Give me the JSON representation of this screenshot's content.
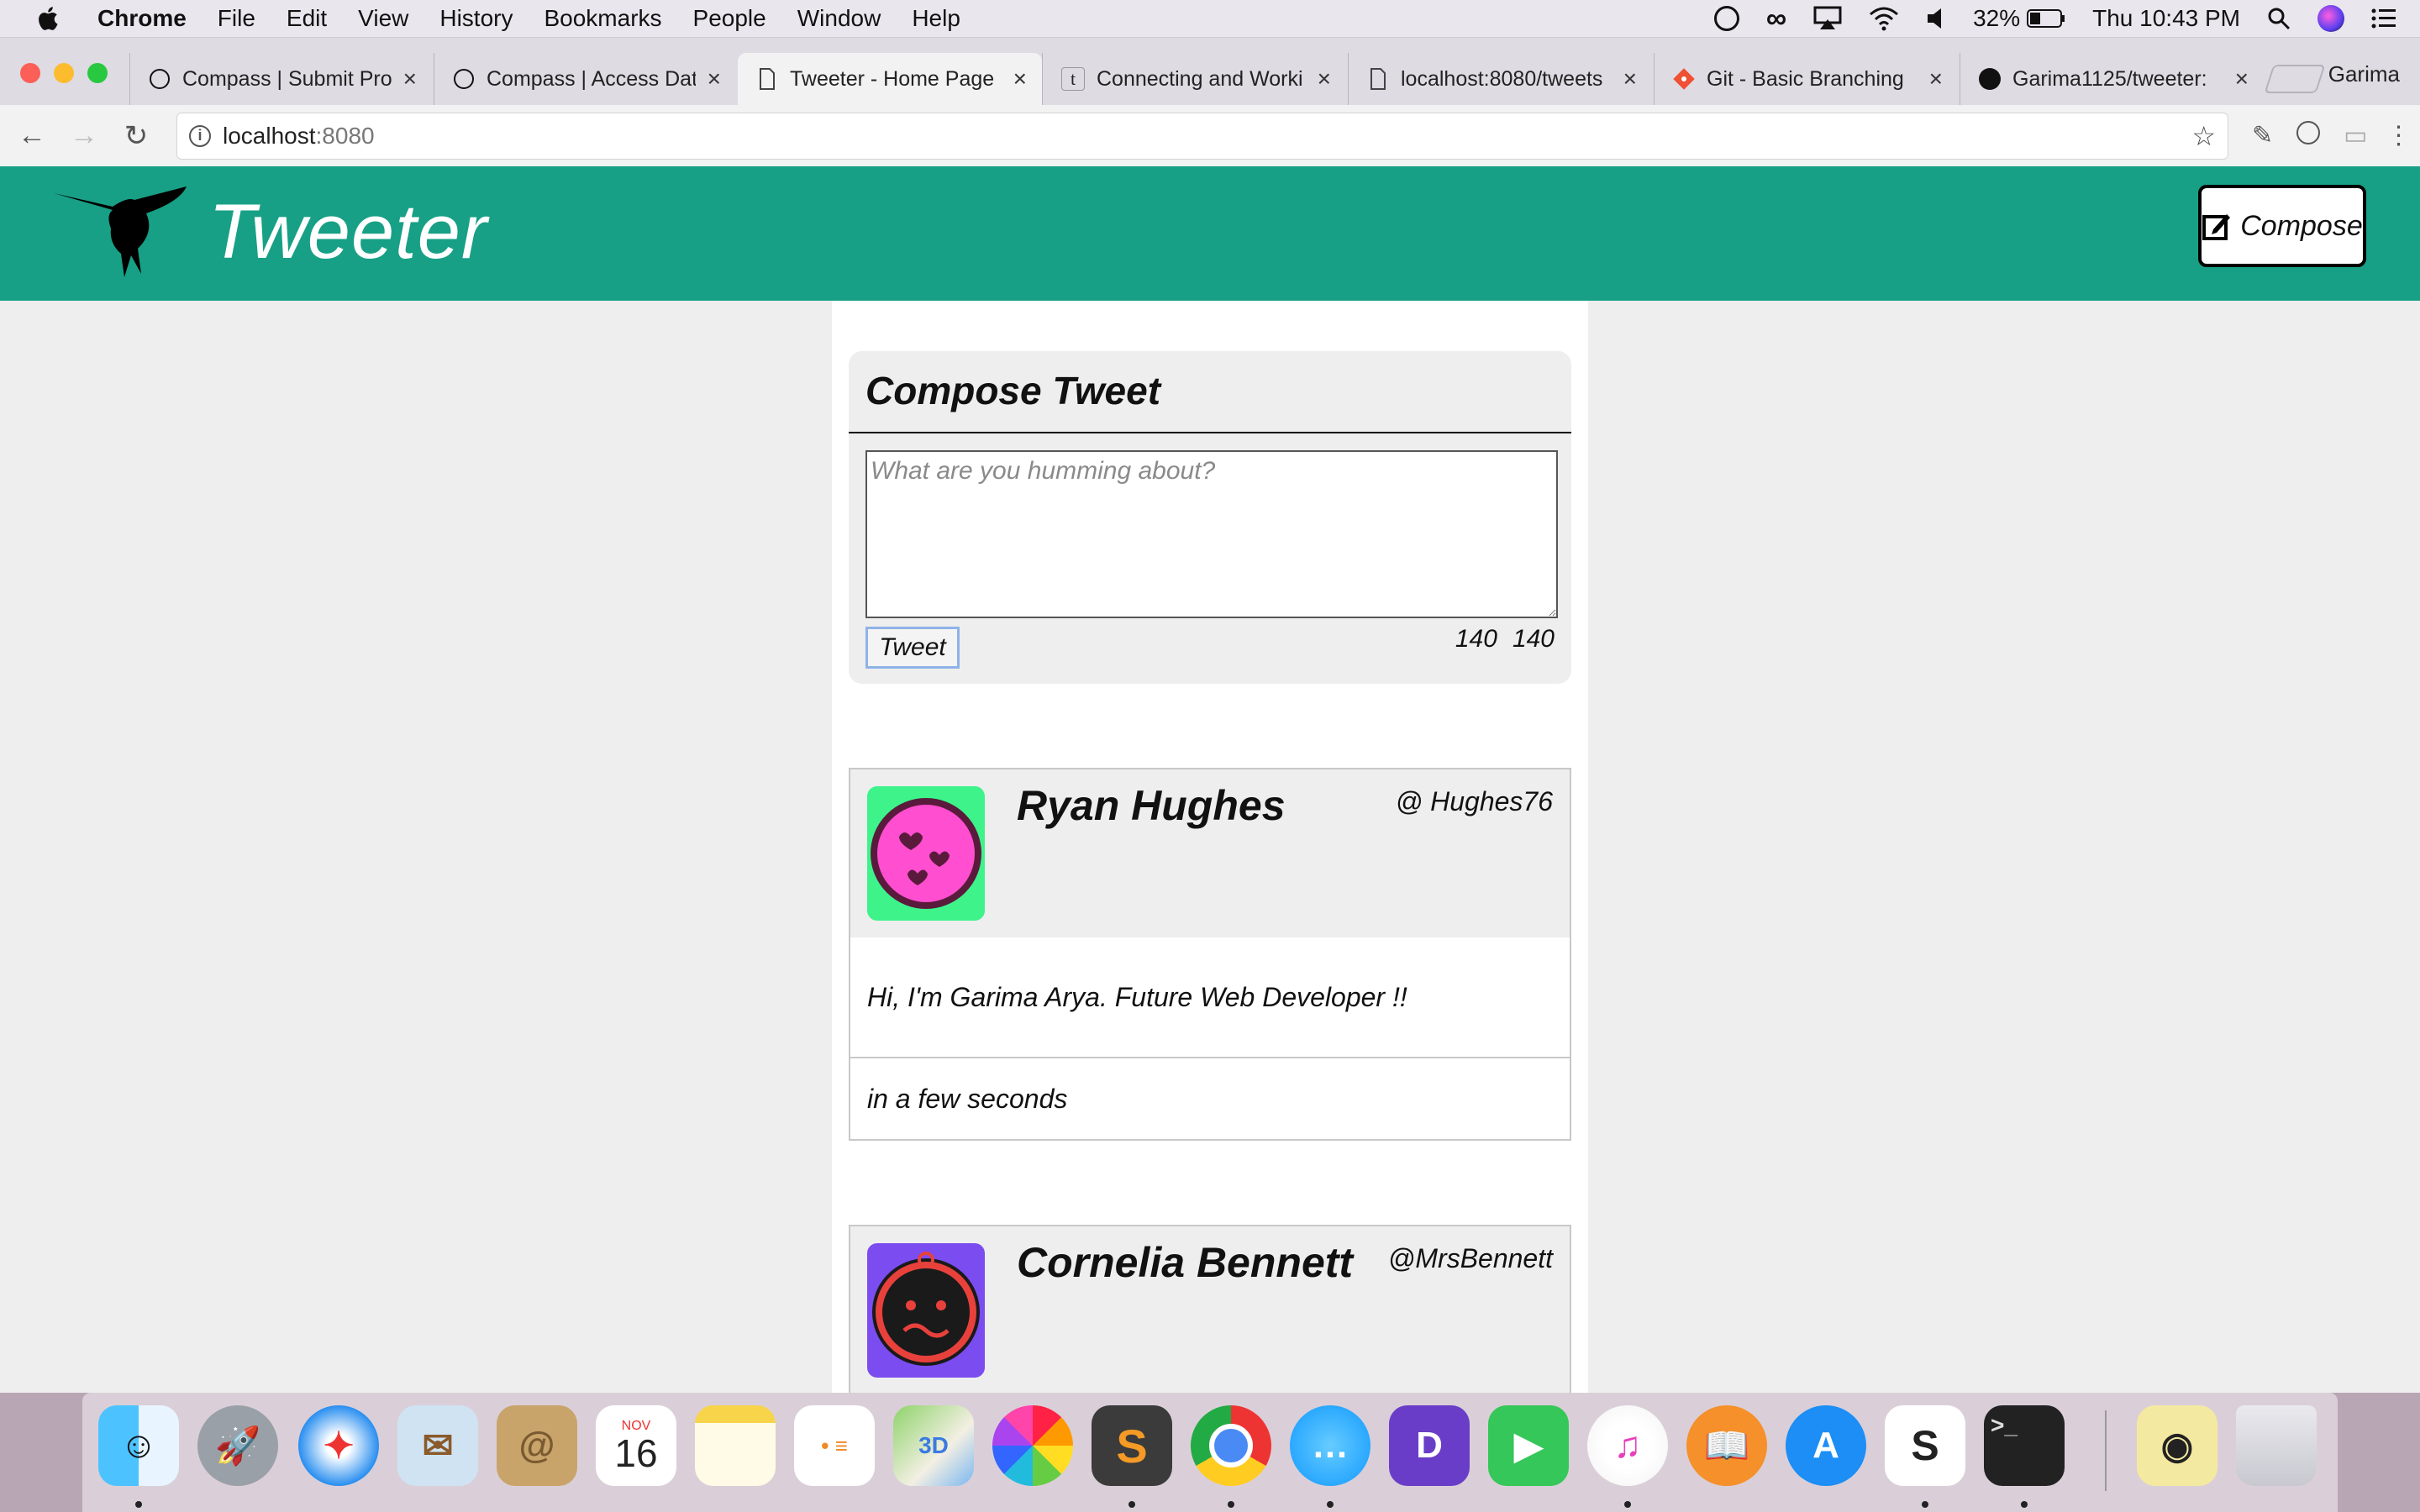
{
  "menubar": {
    "app": "Chrome",
    "menus": [
      "File",
      "Edit",
      "View",
      "History",
      "Bookmarks",
      "People",
      "Window",
      "Help"
    ],
    "battery": "32%",
    "clock": "Thu 10:43 PM"
  },
  "browser": {
    "tabs": [
      {
        "title": "Compass | Submit Pro",
        "icon": "compass-icon",
        "active": false
      },
      {
        "title": "Compass | Access Dat",
        "icon": "compass-icon",
        "active": false
      },
      {
        "title": "Tweeter - Home Page",
        "icon": "page-icon",
        "active": true
      },
      {
        "title": "Connecting and Worki",
        "icon": "t-icon",
        "active": false
      },
      {
        "title": "localhost:8080/tweets",
        "icon": "page-icon",
        "active": false
      },
      {
        "title": "Git - Basic Branching",
        "icon": "git-icon",
        "active": false
      },
      {
        "title": "Garima1125/tweeter:",
        "icon": "github-icon",
        "active": false
      }
    ],
    "profile_name": "Garima",
    "url_host": "localhost",
    "url_port": ":8080"
  },
  "app": {
    "brand": "Tweeter",
    "compose_button": "Compose",
    "new_tweet": {
      "heading": "Compose Tweet",
      "placeholder": "What are you humming about?",
      "submit_label": "Tweet",
      "counter_a": "140",
      "counter_b": "140"
    },
    "tweets": [
      {
        "name": "Ryan Hughes",
        "handle": "@ Hughes76",
        "text": "Hi, I'm Garima Arya. Future Web Developer !!",
        "time": "in a few seconds",
        "avatar_bg": "#3df38a",
        "avatar_face": "#ff4fd0"
      },
      {
        "name": "Cornelia Bennett",
        "handle": "@MrsBennett",
        "avatar_bg": "#7b4cf0",
        "avatar_face": "#e8413c"
      }
    ]
  },
  "colors": {
    "header": "#17a085",
    "page_bg": "#eeeeee"
  },
  "dock": {
    "calendar_month": "NOV",
    "calendar_day": "16",
    "apps": [
      "finder-icon",
      "launchpad-icon",
      "safari-icon",
      "mail-icon",
      "contacts-icon",
      "calendar-icon",
      "notes-icon",
      "reminders-icon",
      "maps-icon",
      "photos-icon",
      "sublime-icon",
      "chrome-icon",
      "messages-icon",
      "dash-icon",
      "facetime-icon",
      "itunes-icon",
      "ibooks-icon",
      "appstore-icon",
      "slack-icon",
      "terminal-icon",
      "minion-icon",
      "trash-icon"
    ]
  }
}
